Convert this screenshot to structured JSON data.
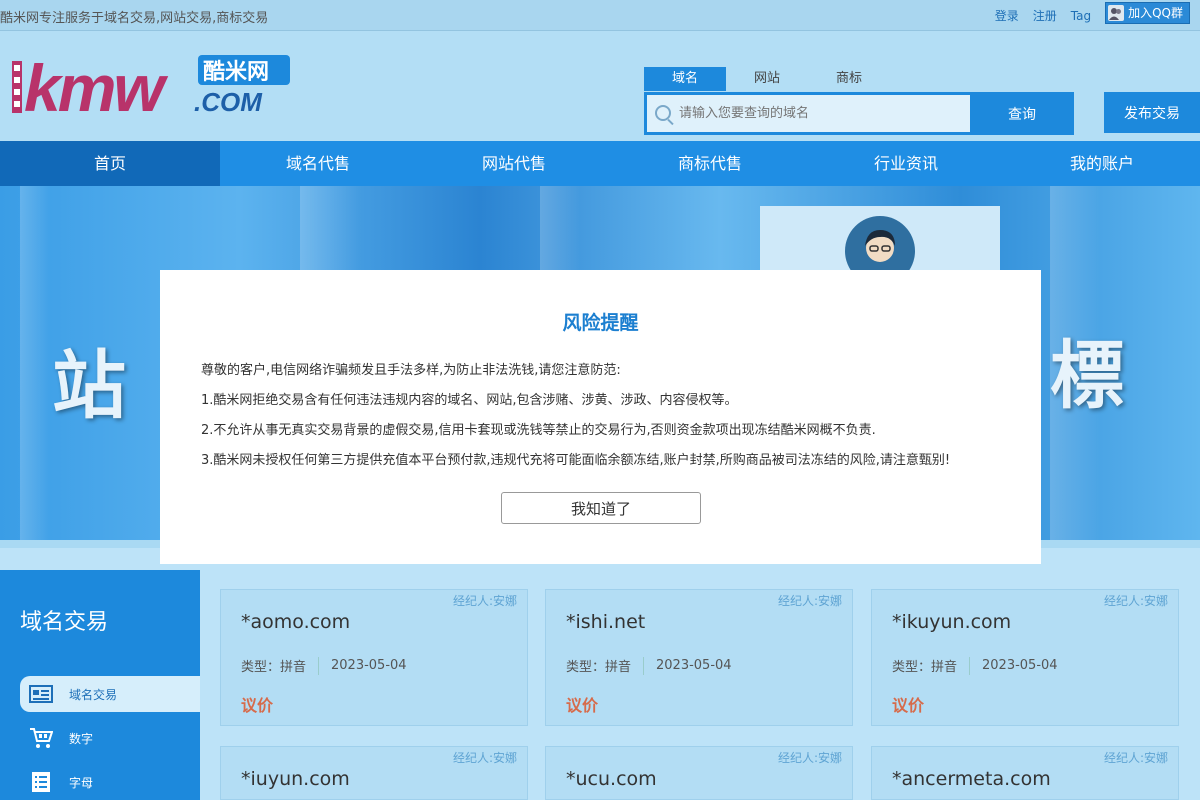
{
  "topbar": {
    "slogan": "酷米网专注服务于域名交易,网站交易,商标交易",
    "login": "登录",
    "register": "注册",
    "tag": "Tag",
    "qq_group": "加入QQ群"
  },
  "logo": {
    "main": "kmw",
    "dot_com": ".COM",
    "badge": "酷米网"
  },
  "search": {
    "tabs": [
      "域名",
      "网站",
      "商标"
    ],
    "placeholder": "请输入您要查询的域名",
    "button": "查询"
  },
  "publish_button": "发布交易",
  "nav": [
    "首页",
    "域名代售",
    "网站代售",
    "商标代售",
    "行业资讯",
    "我的账户"
  ],
  "banner": {
    "chars": [
      "站",
      "標"
    ]
  },
  "modal": {
    "title": "风险提醒",
    "intro": "尊敬的客户,电信网络诈骗频发且手法多样,为防止非法洗钱,请您注意防范:",
    "items": [
      "1.酷米网拒绝交易含有任何违法违规内容的域名、网站,包含涉赌、涉黄、涉政、内容侵权等。",
      "2.不允许从事无真实交易背景的虚假交易,信用卡套现或洗钱等禁止的交易行为,否则资金款项出现冻结酷米网概不负责.",
      "3.酷米网未授权任何第三方提供充值本平台预付款,违规代充将可能面临余额冻结,账户封禁,所购商品被司法冻结的风险,请注意甄别!"
    ],
    "ok_button": "我知道了"
  },
  "sidebar": {
    "title": "域名交易",
    "items": [
      {
        "label": "域名交易",
        "icon": "id-card-icon"
      },
      {
        "label": "数字",
        "icon": "cart-icon"
      },
      {
        "label": "字母",
        "icon": "list-icon"
      }
    ]
  },
  "cards": [
    {
      "agent": "经纪人:安娜",
      "domain": "*aomo.com",
      "type": "类型：拼音",
      "date": "2023-05-04",
      "price": "议价"
    },
    {
      "agent": "经纪人:安娜",
      "domain": "*ishi.net",
      "type": "类型：拼音",
      "date": "2023-05-04",
      "price": "议价"
    },
    {
      "agent": "经纪人:安娜",
      "domain": "*ikuyun.com",
      "type": "类型：拼音",
      "date": "2023-05-04",
      "price": "议价"
    },
    {
      "agent": "经纪人:安娜",
      "domain": "*iuyun.com"
    },
    {
      "agent": "经纪人:安娜",
      "domain": "*ucu.com"
    },
    {
      "agent": "经纪人:安娜",
      "domain": "*ancermeta.com"
    }
  ],
  "colors": {
    "primary": "#1d89dc",
    "nav_active": "#1169b8",
    "price": "#d66b4b",
    "title": "#1c7fd0"
  }
}
